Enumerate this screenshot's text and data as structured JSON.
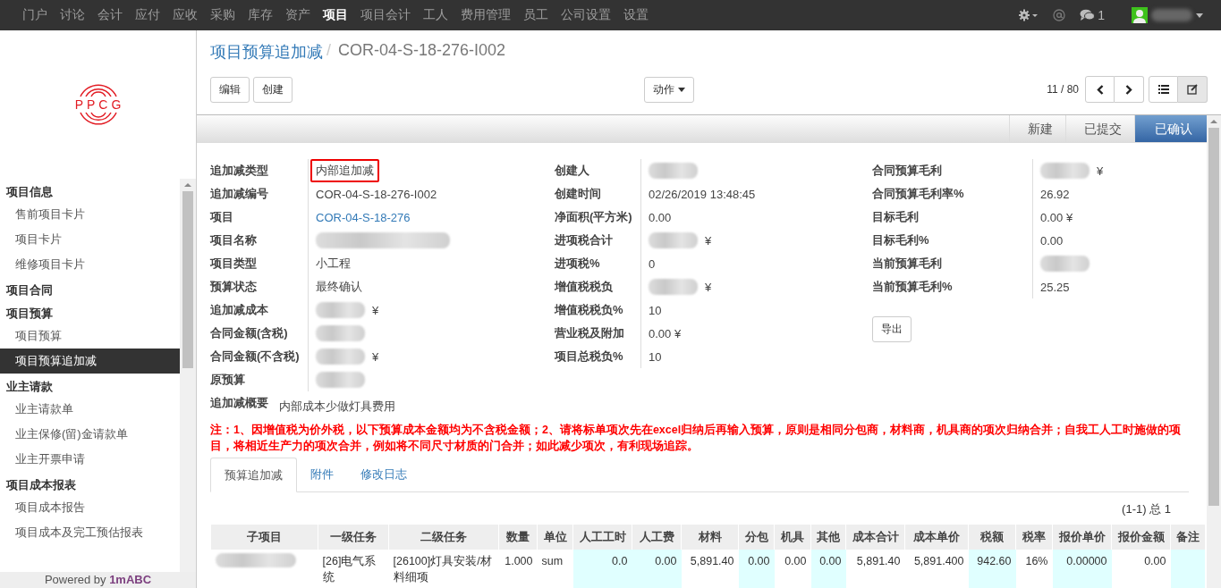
{
  "topnav": {
    "items": [
      {
        "label": "门户",
        "selected": false
      },
      {
        "label": "讨论",
        "selected": false
      },
      {
        "label": "会计",
        "selected": false
      },
      {
        "label": "应付",
        "selected": false
      },
      {
        "label": "应收",
        "selected": false
      },
      {
        "label": "采购",
        "selected": false
      },
      {
        "label": "库存",
        "selected": false
      },
      {
        "label": "资产",
        "selected": false
      },
      {
        "label": "项目",
        "selected": true
      },
      {
        "label": "项目会计",
        "selected": false
      },
      {
        "label": "工人",
        "selected": false
      },
      {
        "label": "费用管理",
        "selected": false
      },
      {
        "label": "员工",
        "selected": false
      },
      {
        "label": "公司设置",
        "selected": false
      },
      {
        "label": "设置",
        "selected": false
      }
    ],
    "message_count": "1"
  },
  "logo": {
    "text": "PPCG"
  },
  "sidebar": {
    "sections": [
      {
        "title": "项目信息",
        "items": [
          {
            "label": "售前项目卡片",
            "selected": false
          },
          {
            "label": "项目卡片",
            "selected": false
          },
          {
            "label": "维修项目卡片",
            "selected": false
          }
        ]
      },
      {
        "title": "项目合同"
      },
      {
        "title": "项目预算",
        "items": [
          {
            "label": "项目预算",
            "selected": false
          },
          {
            "label": "项目预算追加减",
            "selected": true
          }
        ]
      },
      {
        "title": "业主请款",
        "items": [
          {
            "label": "业主请款单",
            "selected": false
          },
          {
            "label": "业主保修(留)金请款单",
            "selected": false
          },
          {
            "label": "业主开票申请",
            "selected": false
          }
        ]
      },
      {
        "title": "项目成本报表",
        "items": [
          {
            "label": "项目成本报告",
            "selected": false
          },
          {
            "label": "项目成本及完工预估报表",
            "selected": false
          }
        ]
      }
    ],
    "footer_prefix": "Powered by",
    "footer_brand": "1mABC"
  },
  "breadcrumb": {
    "parent": "项目预算追加减",
    "separator": "/",
    "current": "COR-04-S-18-276-I002"
  },
  "buttons": {
    "left": [
      "编辑",
      "创建"
    ],
    "action": "动作",
    "pager": "11 / 80"
  },
  "status_steps": [
    {
      "label": "新建",
      "selected": false
    },
    {
      "label": "已提交",
      "selected": false
    },
    {
      "label": "已确认",
      "selected": true
    }
  ],
  "field_groups": [
    [
      {
        "label": "追加减类型",
        "kind": "text",
        "value": "内部追加减",
        "highlighted": true
      },
      {
        "label": "追加减编号",
        "kind": "text",
        "value": "COR-04-S-18-276-I002",
        "highlighted": false
      },
      {
        "label": "项目",
        "kind": "link",
        "value": "COR-04-S-18-276"
      },
      {
        "label": "项目名称",
        "kind": "redacted"
      },
      {
        "label": "项目类型",
        "kind": "text",
        "value": "小工程",
        "highlighted": false
      },
      {
        "label": "预算状态",
        "kind": "text",
        "value": "最终确认",
        "highlighted": false
      },
      {
        "label": "追加减成本",
        "kind": "redacted",
        "suffix": "¥"
      },
      {
        "label": "合同金额(含税)",
        "kind": "redacted"
      },
      {
        "label": "合同金额(不含税)",
        "kind": "redacted",
        "suffix": "¥"
      },
      {
        "label": "原预算",
        "kind": "redacted"
      }
    ],
    [
      {
        "label": "创建人",
        "kind": "redacted"
      },
      {
        "label": "创建时间",
        "kind": "text",
        "value": "02/26/2019 13:48:45",
        "highlighted": false
      },
      {
        "label": "净面积(平方米)",
        "kind": "text",
        "value": "0.00",
        "highlighted": false
      },
      {
        "label": "进项税合计",
        "kind": "redacted",
        "suffix": "¥"
      },
      {
        "label": "进项税%",
        "kind": "text",
        "value": "0",
        "highlighted": false
      },
      {
        "label": "增值税税负",
        "kind": "redacted",
        "suffix": "¥"
      },
      {
        "label": "增值税税负%",
        "kind": "text",
        "value": "10",
        "highlighted": false
      },
      {
        "label": "营业税及附加",
        "kind": "text",
        "value": "0.00 ¥",
        "highlighted": false
      },
      {
        "label": "项目总税负%",
        "kind": "text",
        "value": "10",
        "highlighted": false
      }
    ],
    [
      {
        "label": "合同预算毛利",
        "kind": "redacted",
        "suffix": "¥"
      },
      {
        "label": "合同预算毛利率%",
        "kind": "text",
        "value": "26.92",
        "highlighted": false
      },
      {
        "label": "目标毛利",
        "kind": "text",
        "value": "0.00 ¥",
        "highlighted": false
      },
      {
        "label": "目标毛利%",
        "kind": "text",
        "value": "0.00",
        "highlighted": false
      },
      {
        "label": "当前预算毛利",
        "kind": "redacted"
      },
      {
        "label": "当前预算毛利%",
        "kind": "text",
        "value": "25.25",
        "highlighted": false
      }
    ]
  ],
  "export_button": "导出",
  "summary": {
    "label": "追加减概要",
    "value": "内部成本少做灯具费用"
  },
  "note": "注：1、因增值税为价外税，以下预算成本金额均为不含税金额；2、请将标单项次先在excel归纳后再输入预算，原则是相同分包商，材料商，机具商的项次归纳合并；自我工人工时施做的项目，将相近生产力的项次合并，例如将不同尺寸材质的门合并；如此减少项次，有利现场追踪。",
  "tabs": [
    {
      "label": "预算追加减",
      "selected": true
    },
    {
      "label": "附件",
      "selected": false
    },
    {
      "label": "修改日志",
      "selected": false
    }
  ],
  "table": {
    "count": "(1-1) 总 1",
    "columns": [
      {
        "label": "子项目",
        "editable": false
      },
      {
        "label": "一级任务",
        "editable": false
      },
      {
        "label": "二级任务",
        "editable": false
      },
      {
        "label": "数量",
        "editable": false
      },
      {
        "label": "单位",
        "editable": false
      },
      {
        "label": "人工工时",
        "editable": true
      },
      {
        "label": "人工费",
        "editable": true
      },
      {
        "label": "材料",
        "editable": false
      },
      {
        "label": "分包",
        "editable": true
      },
      {
        "label": "机具",
        "editable": false
      },
      {
        "label": "其他",
        "editable": true
      },
      {
        "label": "成本合计",
        "editable": false
      },
      {
        "label": "成本单价",
        "editable": false
      },
      {
        "label": "税额",
        "editable": true
      },
      {
        "label": "税率",
        "editable": false
      },
      {
        "label": "报价单价",
        "editable": true
      },
      {
        "label": "报价金额",
        "editable": false
      },
      {
        "label": "备注",
        "editable": true
      }
    ],
    "rows": [
      {
        "cells": [
          {
            "kind": "redacted"
          },
          {
            "kind": "text",
            "value": "[26]电气系统"
          },
          {
            "kind": "text",
            "value": "[26100]灯具安装/材料细项"
          },
          {
            "kind": "number",
            "value": "1.000"
          },
          {
            "kind": "text",
            "value": "sum"
          },
          {
            "kind": "number",
            "value": "0.0"
          },
          {
            "kind": "number",
            "value": "0.00"
          },
          {
            "kind": "number",
            "value": "5,891.40"
          },
          {
            "kind": "number",
            "value": "0.00"
          },
          {
            "kind": "number",
            "value": "0.00"
          },
          {
            "kind": "number",
            "value": "0.00"
          },
          {
            "kind": "number",
            "value": "5,891.40"
          },
          {
            "kind": "number",
            "value": "5,891.400"
          },
          {
            "kind": "number",
            "value": "942.60"
          },
          {
            "kind": "number",
            "value": "16%"
          },
          {
            "kind": "number",
            "value": "0.00000"
          },
          {
            "kind": "number",
            "value": "0.00"
          },
          {
            "kind": "empty"
          }
        ]
      }
    ]
  }
}
